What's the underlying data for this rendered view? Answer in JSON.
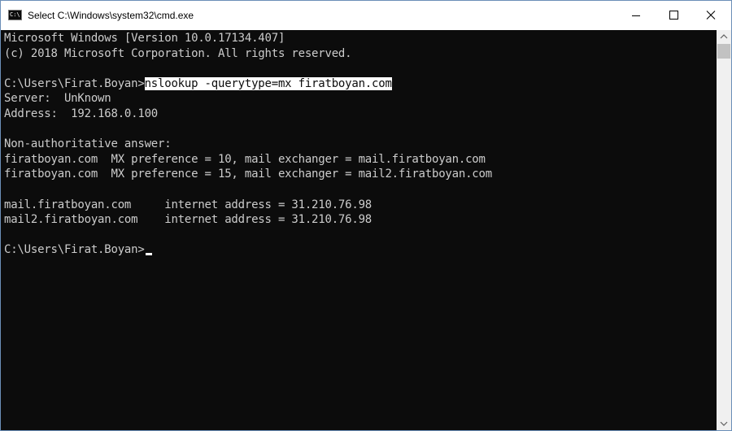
{
  "window": {
    "title": "Select C:\\Windows\\system32\\cmd.exe",
    "icon": "cmd-console-icon",
    "icon_text": "C:\\"
  },
  "console": {
    "lines": [
      "Microsoft Windows [Version 10.0.17134.407]",
      "(c) 2018 Microsoft Corporation. All rights reserved.",
      "",
      "C:\\Users\\Firat.Boyan>",
      "Server:  UnKnown",
      "Address:  192.168.0.100",
      "",
      "Non-authoritative answer:",
      "firatboyan.com  MX preference = 10, mail exchanger = mail.firatboyan.com",
      "firatboyan.com  MX preference = 15, mail exchanger = mail2.firatboyan.com",
      "",
      "mail.firatboyan.com     internet address = 31.210.76.98",
      "mail2.firatboyan.com    internet address = 31.210.76.98",
      "",
      "C:\\Users\\Firat.Boyan>"
    ],
    "selected_command": "nslookup -querytype=mx firatboyan.com"
  },
  "colors": {
    "console_bg": "#0c0c0c",
    "console_text": "#cccccc",
    "selection_bg": "#ffffff",
    "selection_text": "#0c0c0c"
  },
  "icons": {
    "minimize": "minimize-icon",
    "maximize": "maximize-icon",
    "close": "close-icon",
    "scroll_up": "scroll-up-arrow-icon",
    "scroll_down": "scroll-down-arrow-icon"
  }
}
